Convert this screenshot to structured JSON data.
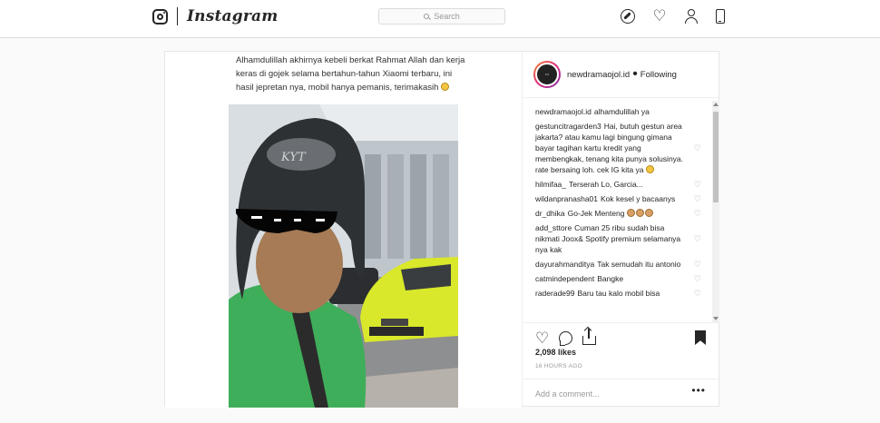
{
  "nav": {
    "wordmark": "Instagram",
    "search_placeholder": "Search",
    "icons": [
      "compass-icon",
      "heart-icon",
      "profile-icon",
      "mobile-icon"
    ]
  },
  "post": {
    "image_caption": "Alhamdulillah akhirnya kebeli berkat Rahmat Allah dan kerja keras di gojek selama bertahun-tahun Xiaomi terbaru, ini hasil jepretan nya, mobil hanya pemanis, terimakasih",
    "author": "newdramaojol.id",
    "follow_state": "Following",
    "likes": "2,098 likes",
    "time": "16 HOURS AGO",
    "add_comment_placeholder": "Add a comment...",
    "comments": [
      {
        "user": "newdramaojol.id",
        "text": "alhamdulillah ya"
      },
      {
        "user": "gestuncitragarden3",
        "text": "Hai, butuh gestun area jakarta? atau kamu lagi bingung gimana bayar tagihan kartu kredit yang membengkak, tenang kita punya solusinya. rate bersaing loh. cek IG kita ya"
      },
      {
        "user": "hilmifaa_",
        "text": "Terserah Lo, Garcia..."
      },
      {
        "user": "wildanpranasha01",
        "text": "Kok kesel y bacaanys"
      },
      {
        "user": "dr_dhika",
        "text": "Go-Jek Menteng"
      },
      {
        "user": "add_sttore",
        "text": "Cuman 25 ribu sudah bisa nikmati Joox& Spotify premium selamanya nya kak"
      },
      {
        "user": "dayurahmanditya",
        "text": "Tak semudah itu antonio"
      },
      {
        "user": "catmindependent",
        "text": "Bangke"
      },
      {
        "user": "raderade99",
        "text": "Baru tau kalo mobil bisa"
      }
    ]
  },
  "colors": {
    "border": "#dbdbdb",
    "text": "#262626",
    "muted": "#999999",
    "car": "#d9e82a",
    "jacket": "#3fae5a"
  }
}
